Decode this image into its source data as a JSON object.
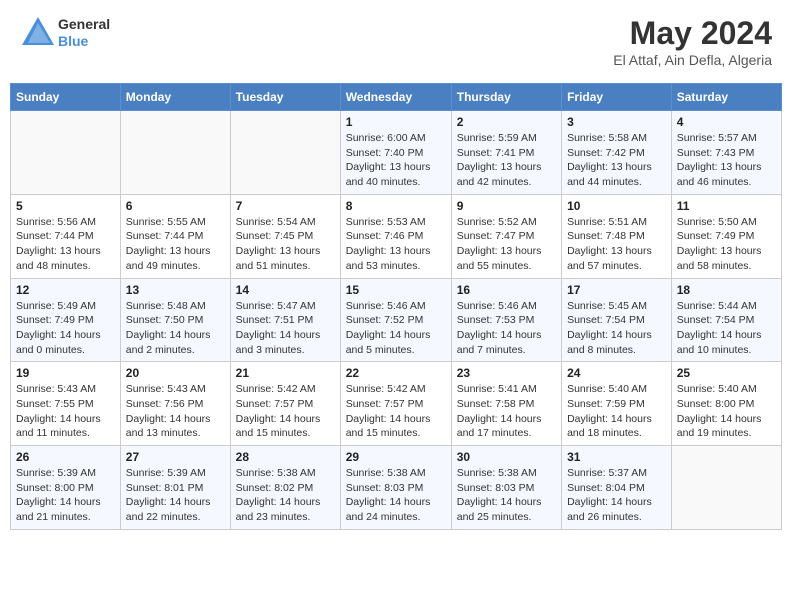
{
  "header": {
    "logo_line1": "General",
    "logo_line2": "Blue",
    "month": "May 2024",
    "location": "El Attaf, Ain Defla, Algeria"
  },
  "weekdays": [
    "Sunday",
    "Monday",
    "Tuesday",
    "Wednesday",
    "Thursday",
    "Friday",
    "Saturday"
  ],
  "weeks": [
    [
      {
        "day": "",
        "info": ""
      },
      {
        "day": "",
        "info": ""
      },
      {
        "day": "",
        "info": ""
      },
      {
        "day": "1",
        "info": "Sunrise: 6:00 AM\nSunset: 7:40 PM\nDaylight: 13 hours\nand 40 minutes."
      },
      {
        "day": "2",
        "info": "Sunrise: 5:59 AM\nSunset: 7:41 PM\nDaylight: 13 hours\nand 42 minutes."
      },
      {
        "day": "3",
        "info": "Sunrise: 5:58 AM\nSunset: 7:42 PM\nDaylight: 13 hours\nand 44 minutes."
      },
      {
        "day": "4",
        "info": "Sunrise: 5:57 AM\nSunset: 7:43 PM\nDaylight: 13 hours\nand 46 minutes."
      }
    ],
    [
      {
        "day": "5",
        "info": "Sunrise: 5:56 AM\nSunset: 7:44 PM\nDaylight: 13 hours\nand 48 minutes."
      },
      {
        "day": "6",
        "info": "Sunrise: 5:55 AM\nSunset: 7:44 PM\nDaylight: 13 hours\nand 49 minutes."
      },
      {
        "day": "7",
        "info": "Sunrise: 5:54 AM\nSunset: 7:45 PM\nDaylight: 13 hours\nand 51 minutes."
      },
      {
        "day": "8",
        "info": "Sunrise: 5:53 AM\nSunset: 7:46 PM\nDaylight: 13 hours\nand 53 minutes."
      },
      {
        "day": "9",
        "info": "Sunrise: 5:52 AM\nSunset: 7:47 PM\nDaylight: 13 hours\nand 55 minutes."
      },
      {
        "day": "10",
        "info": "Sunrise: 5:51 AM\nSunset: 7:48 PM\nDaylight: 13 hours\nand 57 minutes."
      },
      {
        "day": "11",
        "info": "Sunrise: 5:50 AM\nSunset: 7:49 PM\nDaylight: 13 hours\nand 58 minutes."
      }
    ],
    [
      {
        "day": "12",
        "info": "Sunrise: 5:49 AM\nSunset: 7:49 PM\nDaylight: 14 hours\nand 0 minutes."
      },
      {
        "day": "13",
        "info": "Sunrise: 5:48 AM\nSunset: 7:50 PM\nDaylight: 14 hours\nand 2 minutes."
      },
      {
        "day": "14",
        "info": "Sunrise: 5:47 AM\nSunset: 7:51 PM\nDaylight: 14 hours\nand 3 minutes."
      },
      {
        "day": "15",
        "info": "Sunrise: 5:46 AM\nSunset: 7:52 PM\nDaylight: 14 hours\nand 5 minutes."
      },
      {
        "day": "16",
        "info": "Sunrise: 5:46 AM\nSunset: 7:53 PM\nDaylight: 14 hours\nand 7 minutes."
      },
      {
        "day": "17",
        "info": "Sunrise: 5:45 AM\nSunset: 7:54 PM\nDaylight: 14 hours\nand 8 minutes."
      },
      {
        "day": "18",
        "info": "Sunrise: 5:44 AM\nSunset: 7:54 PM\nDaylight: 14 hours\nand 10 minutes."
      }
    ],
    [
      {
        "day": "19",
        "info": "Sunrise: 5:43 AM\nSunset: 7:55 PM\nDaylight: 14 hours\nand 11 minutes."
      },
      {
        "day": "20",
        "info": "Sunrise: 5:43 AM\nSunset: 7:56 PM\nDaylight: 14 hours\nand 13 minutes."
      },
      {
        "day": "21",
        "info": "Sunrise: 5:42 AM\nSunset: 7:57 PM\nDaylight: 14 hours\nand 15 minutes."
      },
      {
        "day": "22",
        "info": "Sunrise: 5:42 AM\nSunset: 7:57 PM\nDaylight: 14 hours\nand 15 minutes."
      },
      {
        "day": "23",
        "info": "Sunrise: 5:41 AM\nSunset: 7:58 PM\nDaylight: 14 hours\nand 17 minutes."
      },
      {
        "day": "24",
        "info": "Sunrise: 5:40 AM\nSunset: 7:59 PM\nDaylight: 14 hours\nand 18 minutes."
      },
      {
        "day": "25",
        "info": "Sunrise: 5:40 AM\nSunset: 8:00 PM\nDaylight: 14 hours\nand 19 minutes."
      }
    ],
    [
      {
        "day": "26",
        "info": "Sunrise: 5:39 AM\nSunset: 8:00 PM\nDaylight: 14 hours\nand 21 minutes."
      },
      {
        "day": "27",
        "info": "Sunrise: 5:39 AM\nSunset: 8:01 PM\nDaylight: 14 hours\nand 22 minutes."
      },
      {
        "day": "28",
        "info": "Sunrise: 5:38 AM\nSunset: 8:02 PM\nDaylight: 14 hours\nand 23 minutes."
      },
      {
        "day": "29",
        "info": "Sunrise: 5:38 AM\nSunset: 8:03 PM\nDaylight: 14 hours\nand 24 minutes."
      },
      {
        "day": "30",
        "info": "Sunrise: 5:38 AM\nSunset: 8:03 PM\nDaylight: 14 hours\nand 25 minutes."
      },
      {
        "day": "31",
        "info": "Sunrise: 5:37 AM\nSunset: 8:04 PM\nDaylight: 14 hours\nand 26 minutes."
      },
      {
        "day": "",
        "info": ""
      }
    ]
  ]
}
